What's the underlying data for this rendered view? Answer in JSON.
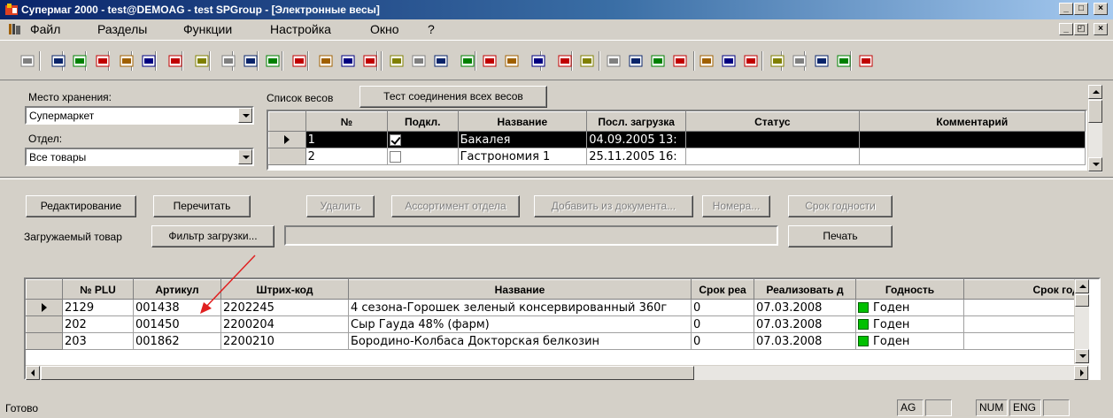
{
  "window": {
    "title": "Супермаг 2000 - test@DEMOAG - test SPGroup - [Электронные весы]",
    "caption_buttons": [
      "minimize",
      "maximize",
      "close"
    ]
  },
  "menu": {
    "items": [
      "Файл",
      "Разделы",
      "Функции",
      "Настройка",
      "Окно",
      "?"
    ]
  },
  "toolbar": {
    "icon_colors": [
      "#808080",
      "#0a246a",
      "#008000",
      "#c00000",
      "#a06000",
      "#000080",
      "#c00000",
      "#808000"
    ]
  },
  "filters": {
    "storage_label": "Место хранения:",
    "storage_value": "Супермаркет",
    "dept_label": "Отдел:",
    "dept_value": "Все товары"
  },
  "scales": {
    "list_label": "Список весов",
    "test_button": "Тест соединения всех весов",
    "columns": [
      "№",
      "Подкл.",
      "Название",
      "Посл. загрузка",
      "Статус",
      "Комментарий"
    ],
    "rows": [
      {
        "num": "1",
        "connected": true,
        "name": "Бакалея",
        "last_load": "04.09.2005 13:",
        "status": "",
        "comment": ""
      },
      {
        "num": "2",
        "connected": false,
        "name": "Гастрономия 1",
        "last_load": "25.11.2005 16:",
        "status": "",
        "comment": ""
      }
    ]
  },
  "actions": {
    "edit": "Редактирование",
    "reread": "Перечитать",
    "delete": "Удалить",
    "dept_assortment": "Ассортимент отдела",
    "add_from_doc": "Добавить из документа...",
    "numbers": "Номера...",
    "shelf_life": "Срок годности",
    "loaded_goods_label": "Загружаемый товар",
    "load_filter": "Фильтр загрузки...",
    "print": "Печать"
  },
  "goods": {
    "columns": [
      "№ PLU",
      "Артикул",
      "Штрих-код",
      "Название",
      "Срок реа",
      "Реализовать д",
      "Годность",
      "Срок годн"
    ],
    "rows": [
      {
        "plu": "2129",
        "article": "001438",
        "barcode": "2202245",
        "name": "4 сезона-Горошек зеленый консервированный 360г",
        "term": "0",
        "sell_by": "07.03.2008",
        "valid": "Годен",
        "shelf": ""
      },
      {
        "plu": "202",
        "article": "001450",
        "barcode": "2200204",
        "name": "Сыр Гауда 48% (фарм)",
        "term": "0",
        "sell_by": "07.03.2008",
        "valid": "Годен",
        "shelf": ""
      },
      {
        "plu": "203",
        "article": "001862",
        "barcode": "2200210",
        "name": "Бородино-Колбаса Докторская белкозин",
        "term": "0",
        "sell_by": "07.03.2008",
        "valid": "Годен",
        "shelf": ""
      }
    ]
  },
  "status": {
    "text": "Готово",
    "panels": [
      "AG",
      "",
      "NUM",
      "ENG",
      ""
    ]
  },
  "colors": {
    "title_bar": "#0a246a",
    "selected_row": "#000000",
    "valid_indicator": "#00c000",
    "annotation_arrow": "#e02020"
  }
}
